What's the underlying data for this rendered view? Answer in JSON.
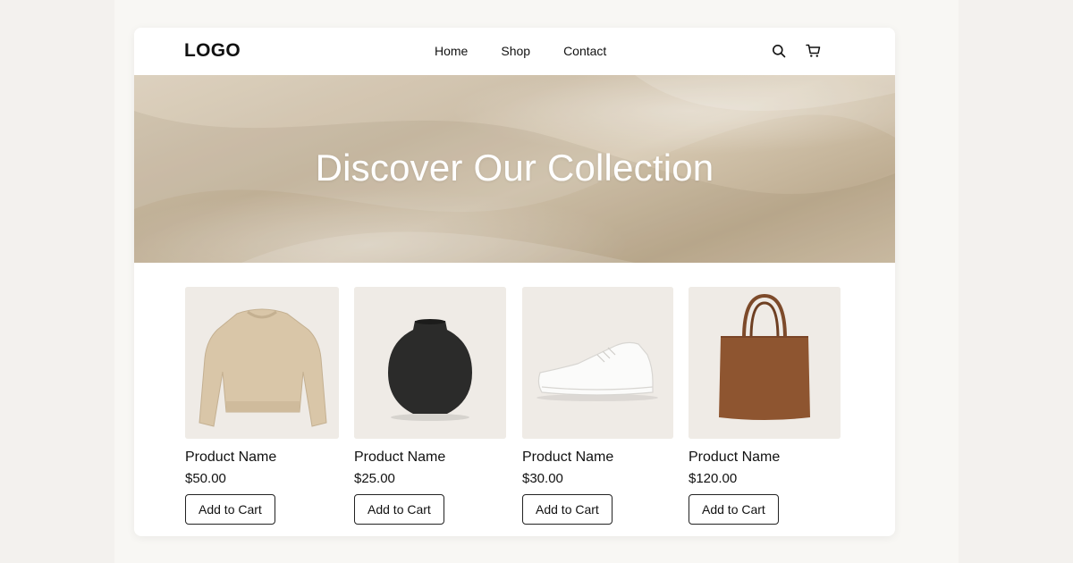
{
  "header": {
    "logo": "LOGO",
    "nav": [
      {
        "label": "Home"
      },
      {
        "label": "Shop"
      },
      {
        "label": "Contact"
      }
    ],
    "icons": [
      "search-icon",
      "cart-icon"
    ]
  },
  "hero": {
    "title": "Discover Our Collection"
  },
  "products": [
    {
      "name": "Product Name",
      "price": "$50.00",
      "button": "Add to Cart",
      "image": "sweater"
    },
    {
      "name": "Product Name",
      "price": "$25.00",
      "button": "Add to Cart",
      "image": "vase"
    },
    {
      "name": "Product Name",
      "price": "$30.00",
      "button": "Add to Cart",
      "image": "sneaker"
    },
    {
      "name": "Product Name",
      "price": "$120.00",
      "button": "Add to Cart",
      "image": "tote-bag"
    }
  ],
  "colors": {
    "page_bg": "#f3f1ee",
    "card_bg": "#ffffff",
    "hero_fabric": "#cbbca3",
    "text": "#111111"
  }
}
